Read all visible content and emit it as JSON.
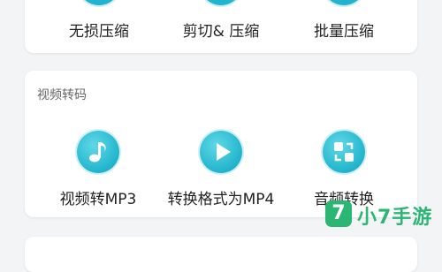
{
  "compress_section": {
    "tools": [
      {
        "label": "无损压缩",
        "icon": "lossless-compress-icon"
      },
      {
        "label": "剪切& 压缩",
        "icon": "cut-compress-icon"
      },
      {
        "label": "批量压缩",
        "icon": "batch-compress-icon"
      }
    ]
  },
  "video_convert_section": {
    "title": "视频转码",
    "tools": [
      {
        "label": "视频转MP3",
        "icon": "music-note-icon"
      },
      {
        "label": "转换格式为MP4",
        "icon": "play-icon"
      },
      {
        "label": "音频转换",
        "icon": "audio-convert-icon"
      }
    ]
  },
  "watermark": {
    "badge": "7",
    "text": "小7手游",
    "color": "#2bb673"
  },
  "colors": {
    "icon_accent": "#22b4cc",
    "card_bg": "#ffffff",
    "page_bg": "#f3f4f6"
  }
}
